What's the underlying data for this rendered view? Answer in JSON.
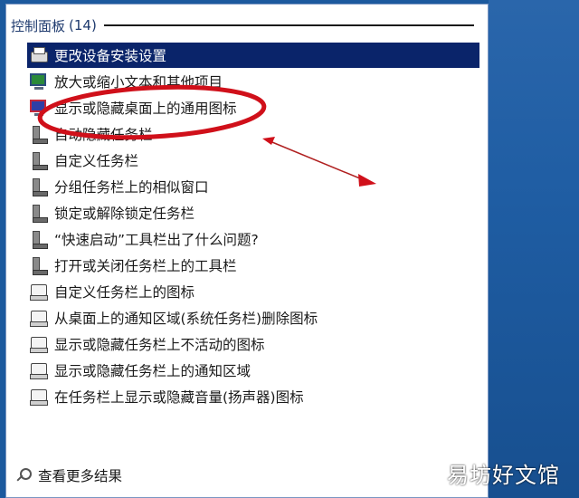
{
  "header": {
    "title": "控制面板",
    "count": "(14)"
  },
  "items": [
    {
      "label": "更改设备安装设置",
      "icon": "printer-icon",
      "selected": true
    },
    {
      "label": "放大或缩小文本和其他项目",
      "icon": "monitor-icon",
      "selected": false
    },
    {
      "label": "显示或隐藏桌面上的通用图标",
      "icon": "desktop-icon",
      "selected": false
    },
    {
      "label": "自动隐藏任务栏",
      "icon": "taskbar-icon",
      "selected": false
    },
    {
      "label": "自定义任务栏",
      "icon": "taskbar-icon",
      "selected": false
    },
    {
      "label": "分组任务栏上的相似窗口",
      "icon": "taskbar-icon",
      "selected": false
    },
    {
      "label": "锁定或解除锁定任务栏",
      "icon": "taskbar-icon",
      "selected": false
    },
    {
      "label": "“快速启动”工具栏出了什么问题?",
      "icon": "taskbar-icon",
      "selected": false
    },
    {
      "label": "打开或关闭任务栏上的工具栏",
      "icon": "taskbar-icon",
      "selected": false
    },
    {
      "label": "自定义任务栏上的图标",
      "icon": "notification-area-icon",
      "selected": false
    },
    {
      "label": "从桌面上的通知区域(系统任务栏)删除图标",
      "icon": "notification-area-icon",
      "selected": false
    },
    {
      "label": "显示或隐藏任务栏上不活动的图标",
      "icon": "notification-area-icon",
      "selected": false
    },
    {
      "label": "显示或隐藏任务栏上的通知区域",
      "icon": "notification-area-icon",
      "selected": false
    },
    {
      "label": "在任务栏上显示或隐藏音量(扬声器)图标",
      "icon": "notification-area-icon",
      "selected": false
    }
  ],
  "footer": {
    "label": "查看更多结果",
    "icon": "search-icon"
  },
  "watermark": "易坊好文馆",
  "colors": {
    "selected_bg": "#0a246a",
    "annotation": "#d0101a",
    "desktop_bg": "#1c5a9e"
  }
}
